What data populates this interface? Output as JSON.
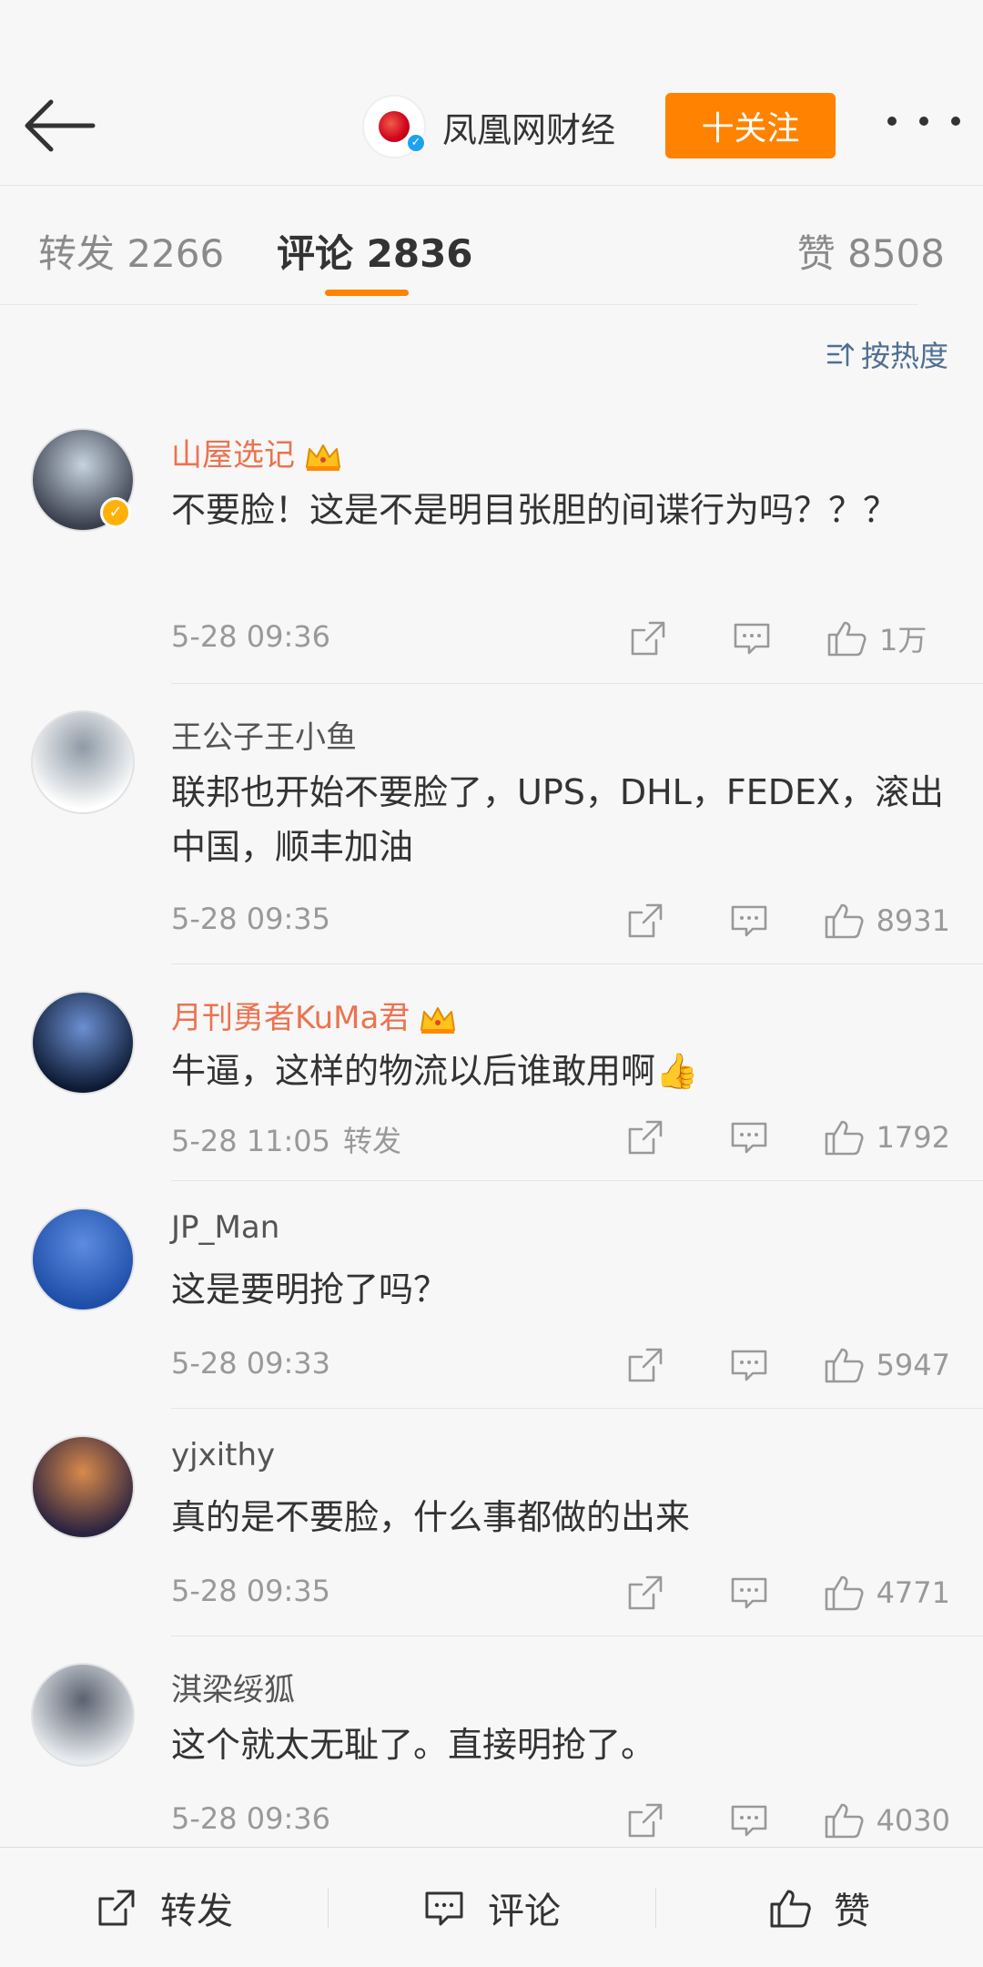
{
  "header": {
    "account_name": "凤凰网财经",
    "follow_label": "十关注"
  },
  "tabs": {
    "repost": "转发 2266",
    "comments": "评论 2836",
    "likes": "赞 8508"
  },
  "sort": {
    "label": "按热度"
  },
  "comments": [
    {
      "user": "山屋选记",
      "text": "不要脸！这是不是明目张胆的间谍行为吗？？？",
      "time": "5-28 09:36",
      "repost_tag": "",
      "likes": "1万",
      "vip": true,
      "verified": true,
      "avatar_colors": [
        "#3a3f4d",
        "#c7d3e0"
      ]
    },
    {
      "user": "王公子王小鱼",
      "text": "联邦也开始不要脸了，UPS，DHL，FEDEX，滚出中国，顺丰加油",
      "time": "5-28 09:35",
      "repost_tag": "",
      "likes": "8931",
      "vip": false,
      "verified": false,
      "avatar_colors": [
        "#ffffff",
        "#8e9aa6"
      ]
    },
    {
      "user": "月刊勇者KuMa君",
      "text": "牛逼，这样的物流以后谁敢用啊👍",
      "time": "5-28 11:05",
      "repost_tag": "转发",
      "likes": "1792",
      "vip": true,
      "verified": false,
      "avatar_colors": [
        "#0d1a33",
        "#6b8fd1"
      ]
    },
    {
      "user": "JP_Man",
      "text": "这是要明抢了吗？",
      "time": "5-28 09:33",
      "repost_tag": "",
      "likes": "5947",
      "vip": false,
      "verified": false,
      "avatar_colors": [
        "#1e4ea8",
        "#5d8be0"
      ]
    },
    {
      "user": "yjxithy",
      "text": "真的是不要脸，什么事都做的出来",
      "time": "5-28 09:35",
      "repost_tag": "",
      "likes": "4771",
      "vip": false,
      "verified": false,
      "avatar_colors": [
        "#2b2340",
        "#d98a4a"
      ]
    },
    {
      "user": "淇梁绥狐",
      "text": "这个就太无耻了。直接明抢了。",
      "time": "5-28 09:36",
      "repost_tag": "",
      "likes": "4030",
      "vip": false,
      "verified": false,
      "avatar_colors": [
        "#e8ebef",
        "#5a6270"
      ]
    }
  ],
  "bottom_bar": {
    "repost": "转发",
    "comment": "评论",
    "like": "赞"
  },
  "colors": {
    "accent": "#ff8200",
    "vip_name": "#eb7350",
    "link_blue": "#4f6f91"
  }
}
